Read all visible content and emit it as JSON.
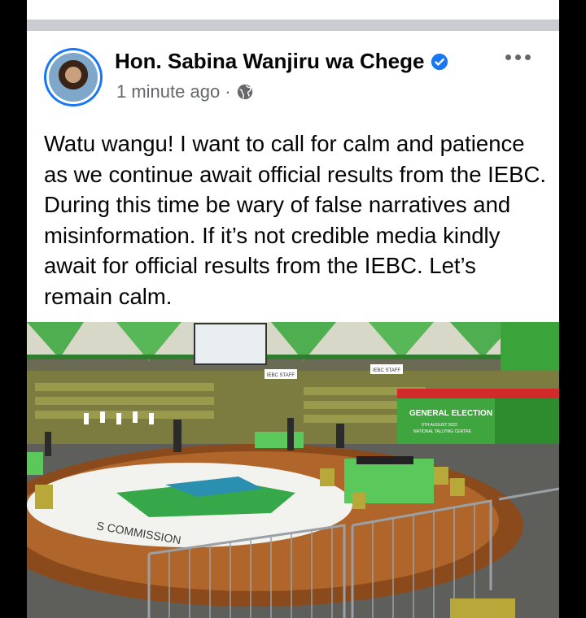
{
  "post": {
    "author": "Hon. Sabina Wanjiru wa Chege",
    "timestamp": "1 minute ago",
    "separator": "·",
    "privacy_icon": "globe-icon",
    "verified_icon": "verified-badge-icon",
    "more_icon": "more-options-icon",
    "text": "Watu wangu! I want to call for calm and patience as we continue await official results from the IEBC. During this time be wary of false narratives and misinformation. If it’s not credible media kindly await for official results from the IEBC. Let’s remain calm."
  },
  "photo": {
    "banner_title": "GENERAL ELECTION",
    "banner_sub1": "9TH AUGUST 2022",
    "banner_sub2": "NATIONAL TALLYING CENTRE",
    "floor_text": "S COMMISSION",
    "staff_sign_1": "IEBC STAFF",
    "staff_sign_2": "IEBC STAFF"
  },
  "colors": {
    "accent": "#1877f2",
    "name": "#050505",
    "meta": "#65676b",
    "divider": "#c9ccd1",
    "iebc_green": "#3aa33a"
  }
}
